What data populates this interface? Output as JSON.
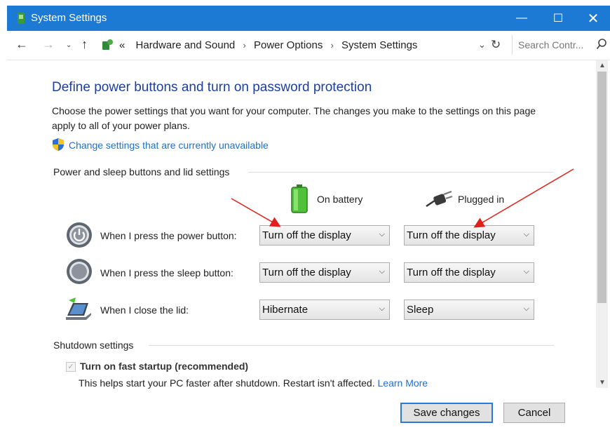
{
  "window": {
    "title": "System Settings",
    "controls": {
      "minimize": "—",
      "maximize": "☐",
      "close": "✕"
    }
  },
  "navigation": {
    "back": "←",
    "forward": "→",
    "recent": "⌄",
    "up": "↑",
    "breadcrumb_lead": "«",
    "breadcrumbs": [
      "Hardware and Sound",
      "Power Options",
      "System Settings"
    ],
    "separator": "›",
    "dropdown": "⌄",
    "refresh": "↻",
    "search_placeholder": "Search Contr..."
  },
  "page": {
    "heading": "Define power buttons and turn on password protection",
    "description": "Choose the power settings that you want for your computer. The changes you make to the settings on this page apply to all of your power plans.",
    "change_link": "Change settings that are currently unavailable"
  },
  "power_section": {
    "title": "Power and sleep buttons and lid settings",
    "columns": {
      "battery": "On battery",
      "plugged": "Plugged in"
    },
    "rows": [
      {
        "label": "When I press the power button:",
        "battery": "Turn off the display",
        "plugged": "Turn off the display",
        "icon": "power-button-icon"
      },
      {
        "label": "When I press the sleep button:",
        "battery": "Turn off the display",
        "plugged": "Turn off the display",
        "icon": "sleep-button-icon"
      },
      {
        "label": "When I close the lid:",
        "battery": "Hibernate",
        "plugged": "Sleep",
        "icon": "laptop-lid-icon"
      }
    ]
  },
  "shutdown_section": {
    "title": "Shutdown settings",
    "fast_startup_label": "Turn on fast startup (recommended)",
    "fast_startup_checked": true,
    "fast_startup_help": "This helps start your PC faster after shutdown. Restart isn't affected.",
    "learn_more": "Learn More"
  },
  "buttons": {
    "save": "Save changes",
    "cancel": "Cancel"
  },
  "colors": {
    "titlebar": "#1c79d4",
    "heading": "#1e3f9e",
    "link": "#1f6fd0",
    "annotation_arrow": "#e0201a"
  }
}
